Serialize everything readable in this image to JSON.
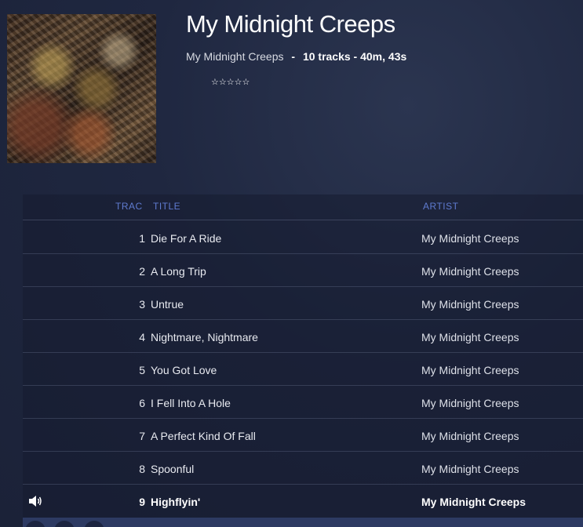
{
  "album": {
    "title": "My Midnight Creeps",
    "artist": "My Midnight Creeps",
    "separator": "-",
    "info": "10 tracks - 40m, 43s",
    "rating": "☆☆☆☆☆"
  },
  "columns": {
    "track": "TRAC",
    "title": "TITLE",
    "artist": "ARTIST"
  },
  "tracks": [
    {
      "num": "1",
      "title": "Die For A Ride",
      "artist": "My Midnight Creeps"
    },
    {
      "num": "2",
      "title": "A Long Trip",
      "artist": "My Midnight Creeps"
    },
    {
      "num": "3",
      "title": "Untrue",
      "artist": "My Midnight Creeps"
    },
    {
      "num": "4",
      "title": "Nightmare, Nightmare",
      "artist": "My Midnight Creeps"
    },
    {
      "num": "5",
      "title": "You Got Love",
      "artist": "My Midnight Creeps"
    },
    {
      "num": "6",
      "title": "I Fell Into A Hole",
      "artist": "My Midnight Creeps"
    },
    {
      "num": "7",
      "title": "A Perfect Kind Of Fall",
      "artist": "My Midnight Creeps"
    },
    {
      "num": "8",
      "title": "Spoonful",
      "artist": "My Midnight Creeps"
    },
    {
      "num": "9",
      "title": "Highflyin'",
      "artist": "My Midnight Creeps",
      "playing": true
    }
  ],
  "icons": {
    "now_playing": "speaker-icon"
  },
  "colors": {
    "header_text": "#5f7bd0",
    "background": "#1f2740"
  }
}
